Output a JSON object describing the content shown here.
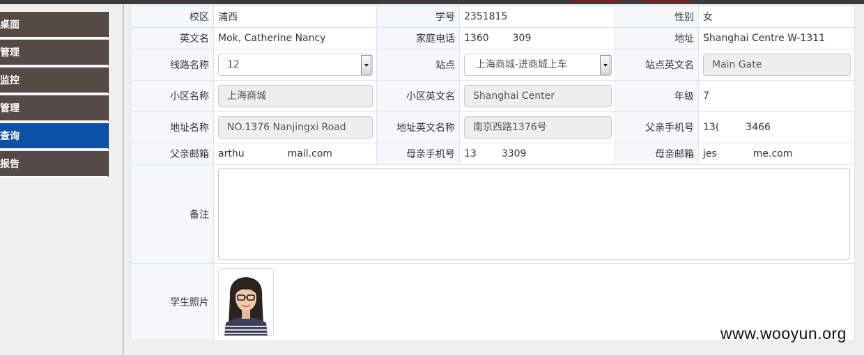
{
  "sidebar": {
    "items": [
      {
        "label": "桌面"
      },
      {
        "label": "管理"
      },
      {
        "label": "监控"
      },
      {
        "label": "管理"
      },
      {
        "label": "查询"
      },
      {
        "label": "报告"
      }
    ],
    "active_color": "#0b51a6",
    "item_color": "#564a44"
  },
  "form": {
    "campus": {
      "label": "校区",
      "value": "浦西"
    },
    "student_id": {
      "label": "学号",
      "value": "2351815"
    },
    "gender": {
      "label": "性别",
      "value": "女"
    },
    "english_name": {
      "label": "英文名",
      "value": "Mok, Catherine Nancy"
    },
    "home_phone": {
      "label": "家庭电话",
      "value": "1360",
      "value_tail": "309"
    },
    "address": {
      "label": "地址",
      "value": "Shanghai Centre W-1311"
    },
    "route_name": {
      "label": "线路名称",
      "value": "12"
    },
    "stop": {
      "label": "站点",
      "value": "上海商城-进商城上车"
    },
    "stop_english_name": {
      "label": "站点英文名",
      "value": "Main Gate"
    },
    "community_name": {
      "label": "小区名称",
      "value": "上海商城"
    },
    "community_english_name": {
      "label": "小区英文名",
      "value": "Shanghai Center"
    },
    "grade": {
      "label": "年级",
      "value": "7"
    },
    "address_name": {
      "label": "地址名称",
      "value": "NO.1376 Nanjingxi Road"
    },
    "address_english_name": {
      "label": "地址英文名称",
      "value": "南京西路1376号"
    },
    "father_mobile": {
      "label": "父亲手机号",
      "value": "13(",
      "value_tail": "3466"
    },
    "father_email": {
      "label": "父亲邮箱",
      "value": "arthu",
      "value_tail": "mail.com"
    },
    "mother_mobile": {
      "label": "母亲手机号",
      "value": "13",
      "value_tail": "3309"
    },
    "mother_email": {
      "label": "母亲邮箱",
      "value": "jes",
      "value_tail": "me.com"
    },
    "remark": {
      "label": "备注",
      "value": ""
    },
    "photo": {
      "label": "学生照片"
    }
  },
  "watermark": "www.wooyun.org"
}
